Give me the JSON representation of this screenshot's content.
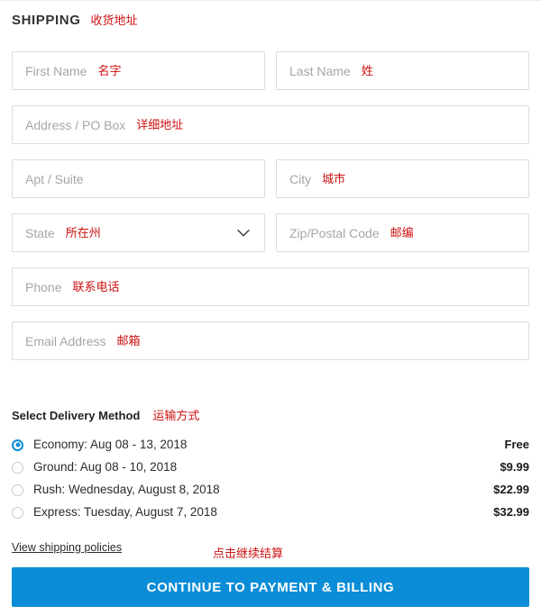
{
  "header": {
    "title": "SHIPPING",
    "annotation": "收货地址"
  },
  "colors": {
    "accent": "#0b8cd6",
    "annotation": "#cc1111",
    "placeholder": "#a6a6a6",
    "field_border": "#dcdcdc"
  },
  "form": {
    "rows": [
      {
        "fields": [
          {
            "name": "first-name",
            "placeholder": "First Name",
            "value": "",
            "annotation": "名字"
          },
          {
            "name": "last-name",
            "placeholder": "Last Name",
            "value": "",
            "annotation": "姓"
          }
        ]
      },
      {
        "fields": [
          {
            "name": "address",
            "placeholder": "Address / PO Box",
            "value": "",
            "annotation": "详细地址"
          }
        ]
      },
      {
        "fields": [
          {
            "name": "apt-suite",
            "placeholder": "Apt / Suite",
            "value": "",
            "annotation": ""
          },
          {
            "name": "city",
            "placeholder": "City",
            "value": "",
            "annotation": "城市"
          }
        ]
      },
      {
        "fields": [
          {
            "name": "state",
            "placeholder": "State",
            "value": "",
            "annotation": "所在州",
            "control": "select",
            "icon": "chevron-down-icon"
          },
          {
            "name": "zip",
            "placeholder": "Zip/Postal Code",
            "value": "",
            "annotation": "邮编"
          }
        ]
      },
      {
        "fields": [
          {
            "name": "phone",
            "placeholder": "Phone",
            "value": "",
            "annotation": "联系电话"
          }
        ]
      },
      {
        "fields": [
          {
            "name": "email",
            "placeholder": "Email Address",
            "value": "",
            "annotation": "邮箱"
          }
        ]
      }
    ]
  },
  "delivery": {
    "title": "Select Delivery Method",
    "annotation": "运输方式",
    "selected_index": 0,
    "options": [
      {
        "label": "Economy: Aug 08 - 13, 2018",
        "price": "Free",
        "selected": true
      },
      {
        "label": "Ground: Aug 08 - 10, 2018",
        "price": "$9.99",
        "selected": false
      },
      {
        "label": "Rush: Wednesday, August 8, 2018",
        "price": "$22.99",
        "selected": false
      },
      {
        "label": "Express: Tuesday, August 7, 2018",
        "price": "$32.99",
        "selected": false
      }
    ]
  },
  "footer": {
    "policies_link": "View shipping policies",
    "cta_annotation": "点击继续结算",
    "cta_label": "CONTINUE TO PAYMENT & BILLING"
  }
}
